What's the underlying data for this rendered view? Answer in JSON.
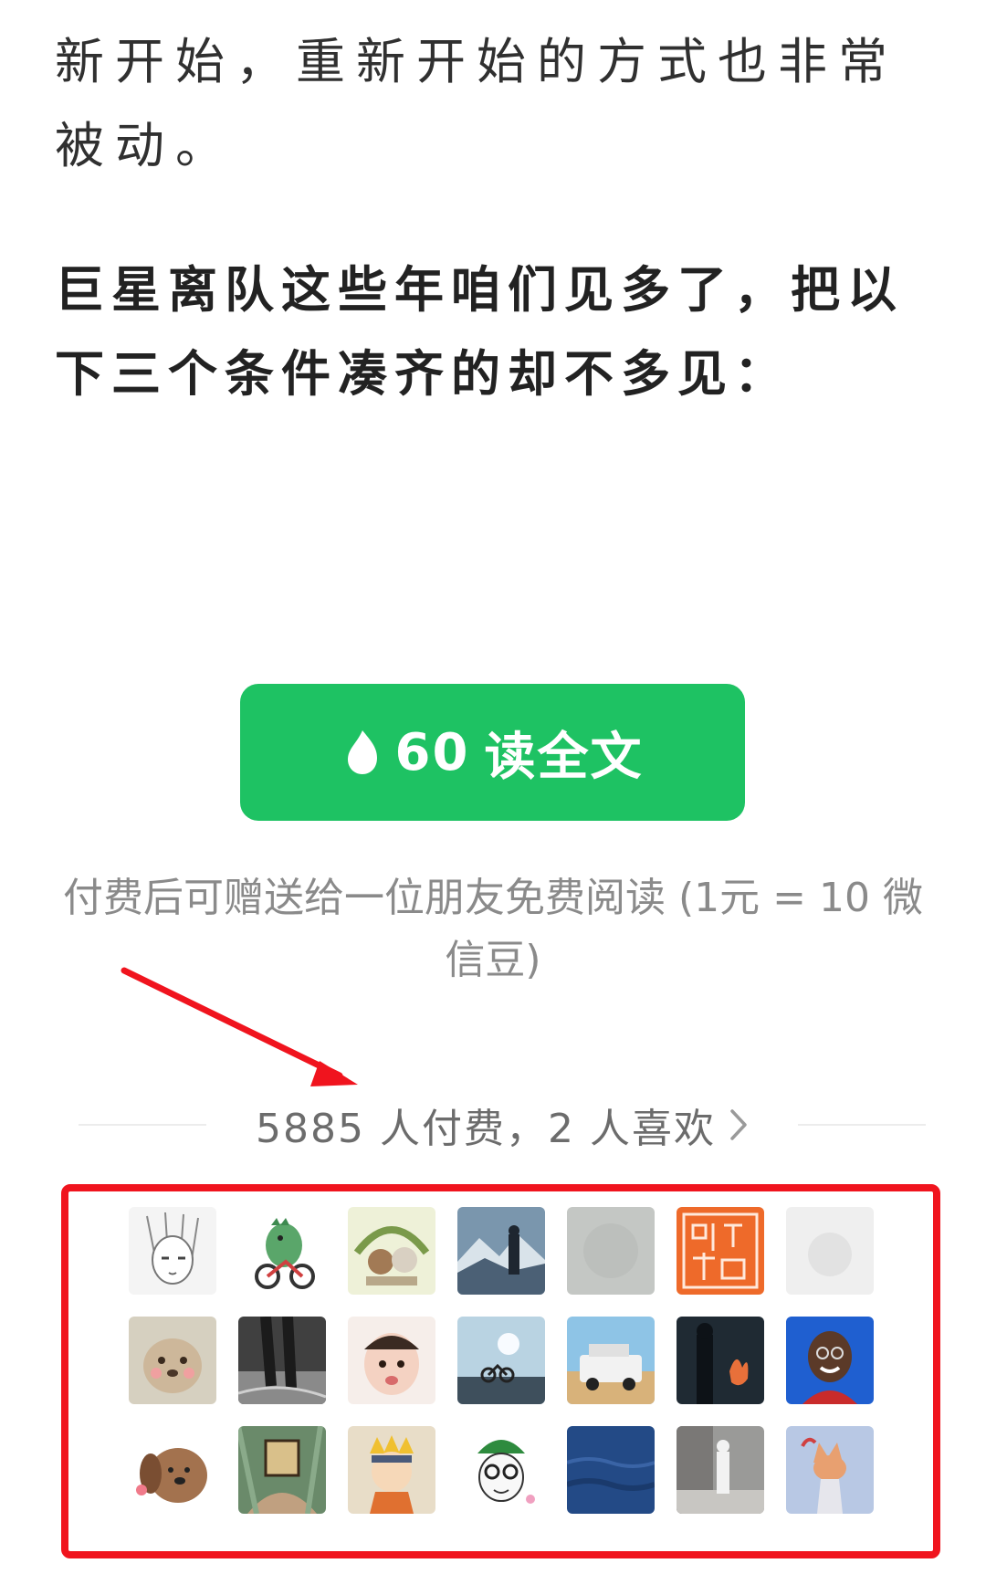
{
  "article": {
    "paragraph_1": "新开始，重新开始的方式也非常被动。",
    "paragraph_2": "巨星离队这些年咱们见多了，把以下三个条件凑齐的却不多见："
  },
  "paywall": {
    "price": "60",
    "button_label": "读全文",
    "gift_note": "付费后可赠送给一位朋友免费阅读 (1元 = 10 微信豆)",
    "stats": "5885 人付费，2 人喜欢"
  },
  "colors": {
    "accent_green": "#1ec263",
    "annotation_red": "#f0141e"
  },
  "avatars": [
    {
      "desc": "manga-girl"
    },
    {
      "desc": "dinosaur-bike"
    },
    {
      "desc": "cartoon-bears"
    },
    {
      "desc": "mountain-silhouette"
    },
    {
      "desc": "blurred-gray"
    },
    {
      "desc": "red-seal"
    },
    {
      "desc": "blurred-light"
    },
    {
      "desc": "puppy-photo"
    },
    {
      "desc": "dark-street"
    },
    {
      "desc": "baby-photo"
    },
    {
      "desc": "bike-sky"
    },
    {
      "desc": "car-desert"
    },
    {
      "desc": "fire-person"
    },
    {
      "desc": "smiling-boy"
    },
    {
      "desc": "cartoon-dog"
    },
    {
      "desc": "painting"
    },
    {
      "desc": "ninja-cartoon"
    },
    {
      "desc": "glasses-cartoon"
    },
    {
      "desc": "blue-water"
    },
    {
      "desc": "street-walker"
    },
    {
      "desc": "fox-figure"
    }
  ]
}
